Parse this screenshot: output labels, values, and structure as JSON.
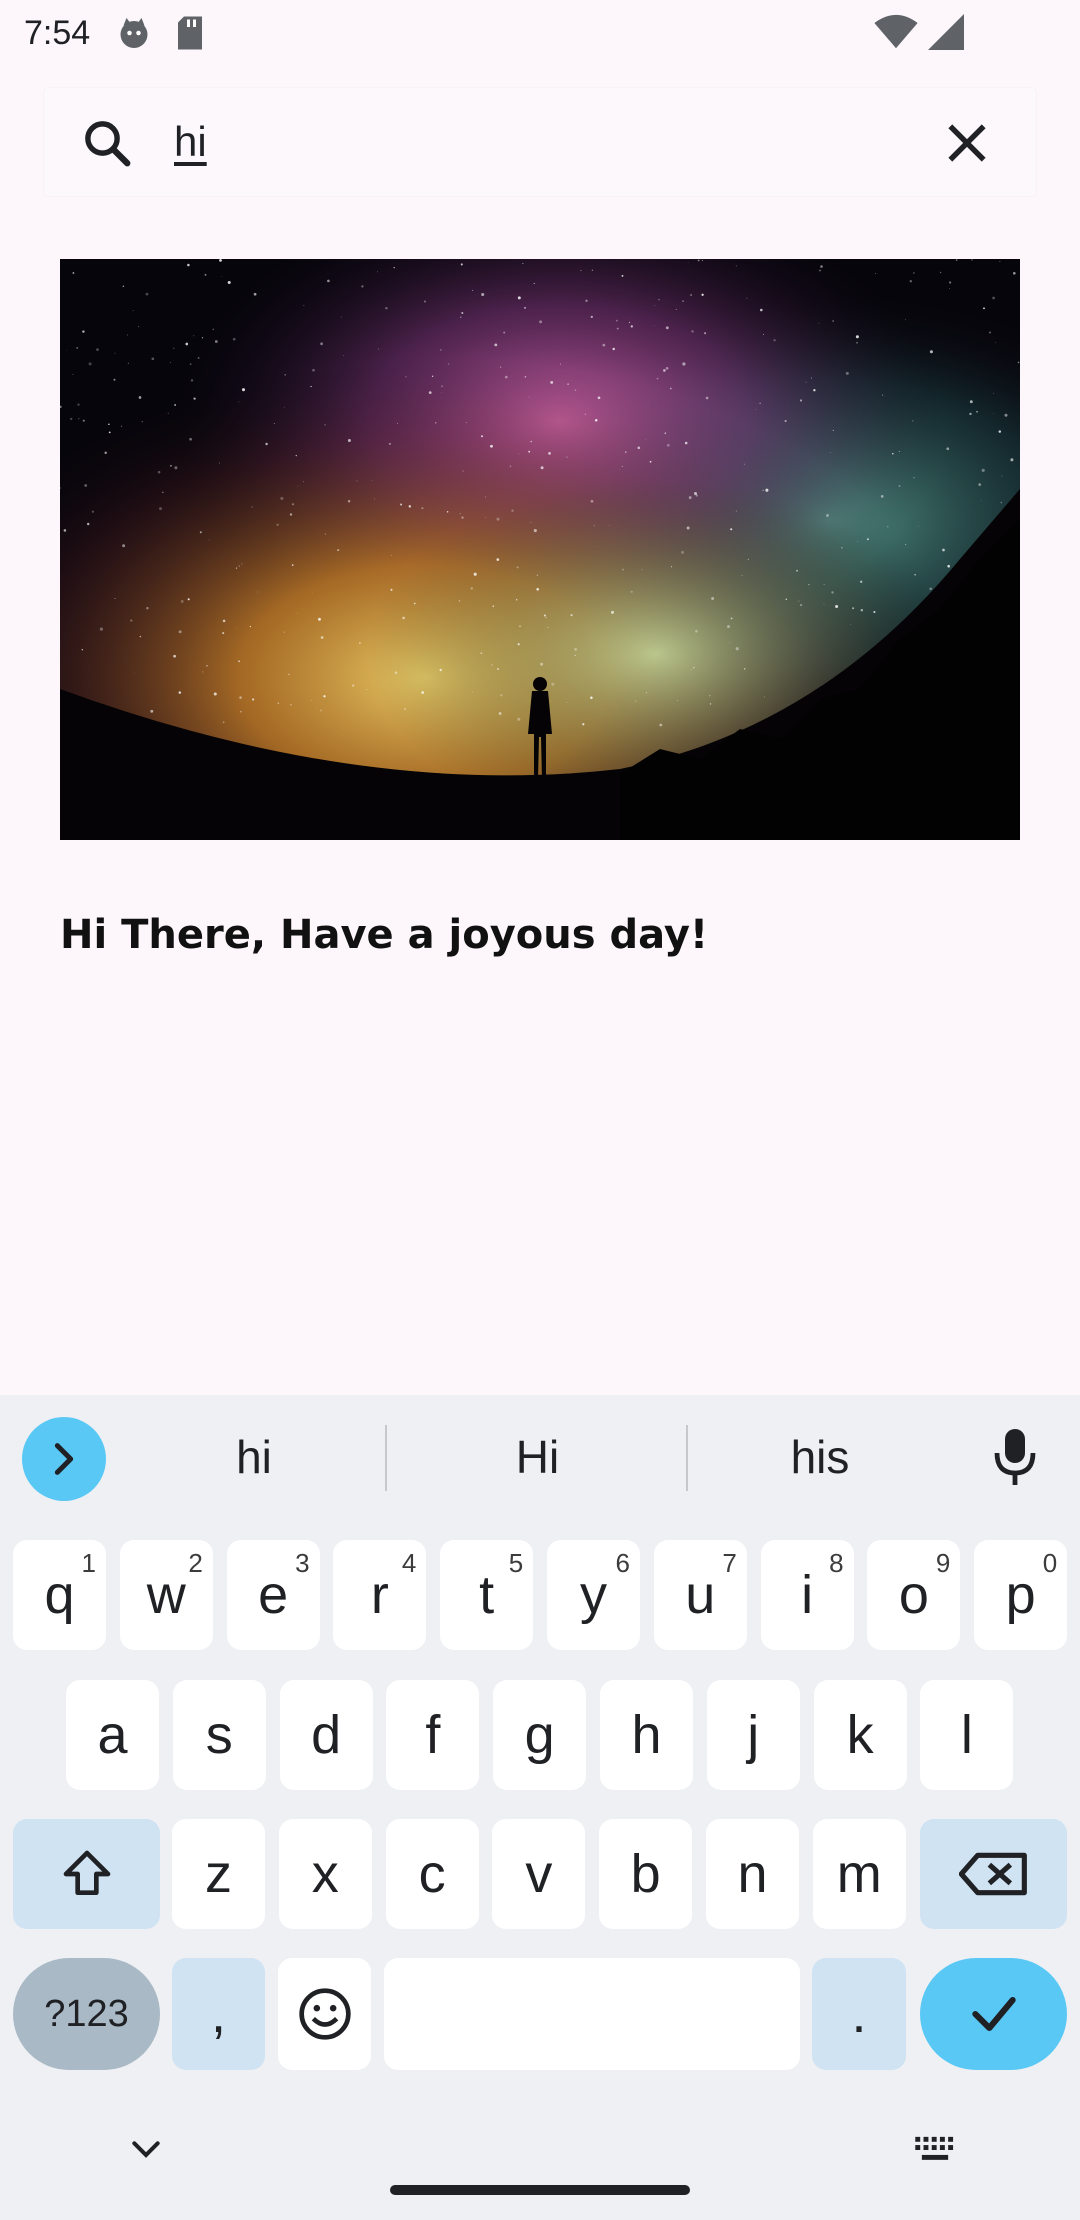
{
  "status_bar": {
    "time": "7:54"
  },
  "search": {
    "query": "hi"
  },
  "result": {
    "title": "Hi There, Have a joyous day!"
  },
  "keyboard": {
    "suggestions": [
      "hi",
      "Hi",
      "his"
    ],
    "row1": [
      {
        "label": "q",
        "hint": "1"
      },
      {
        "label": "w",
        "hint": "2"
      },
      {
        "label": "e",
        "hint": "3"
      },
      {
        "label": "r",
        "hint": "4"
      },
      {
        "label": "t",
        "hint": "5"
      },
      {
        "label": "y",
        "hint": "6"
      },
      {
        "label": "u",
        "hint": "7"
      },
      {
        "label": "i",
        "hint": "8"
      },
      {
        "label": "o",
        "hint": "9"
      },
      {
        "label": "p",
        "hint": "0"
      }
    ],
    "row2": [
      "a",
      "s",
      "d",
      "f",
      "g",
      "h",
      "j",
      "k",
      "l"
    ],
    "row3": [
      "z",
      "x",
      "c",
      "v",
      "b",
      "n",
      "m"
    ],
    "symbols_label": "?123",
    "comma": ",",
    "period": "."
  },
  "colors": {
    "accent": "#5ac8f5",
    "modifier": "#cfe3f3",
    "background": "#fdf7fb"
  }
}
